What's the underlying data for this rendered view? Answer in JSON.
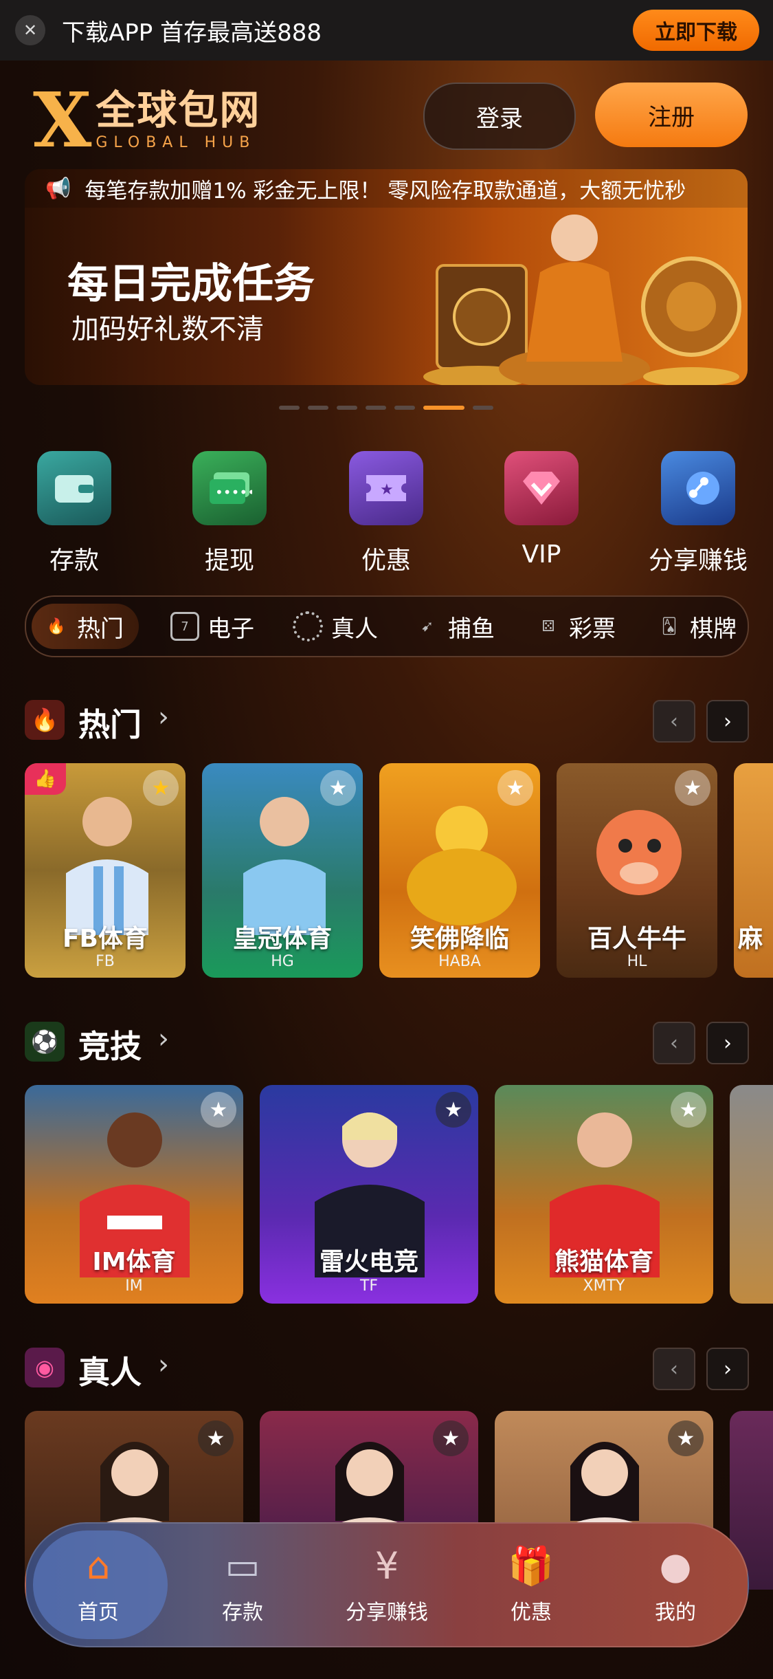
{
  "download_bar": {
    "text": "下载APP 首存最高送888",
    "button": "立即下载"
  },
  "header": {
    "logo_mark": "X",
    "logo_cn": "全球包网",
    "logo_en": "GLOBAL HUB",
    "login": "登录",
    "register": "注册"
  },
  "banner": {
    "marquee": "每笔存款加赠1% 彩金无上限！ 零风险存取款通道，大额无忧秒",
    "title": "每日完成任务",
    "subtitle": "加码好礼数不清",
    "active_slide": 6,
    "slide_count": 7
  },
  "quick_actions": [
    {
      "label": "存款",
      "icon": "wallet-icon"
    },
    {
      "label": "提现",
      "icon": "cash-card-icon"
    },
    {
      "label": "优惠",
      "icon": "coupon-ticket-icon"
    },
    {
      "label": "VIP",
      "icon": "diamond-icon"
    },
    {
      "label": "分享赚钱",
      "icon": "share-icon"
    }
  ],
  "categories": [
    {
      "label": "热门",
      "icon": "flame-icon"
    },
    {
      "label": "电子",
      "icon": "slot-icon"
    },
    {
      "label": "真人",
      "icon": "chip-icon"
    },
    {
      "label": "捕鱼",
      "icon": "fish-icon"
    },
    {
      "label": "彩票",
      "icon": "dice-icon"
    },
    {
      "label": "棋牌",
      "icon": "cards-icon"
    }
  ],
  "sections": {
    "hot": {
      "title": "热门",
      "cards": [
        {
          "name": "FB体育",
          "code": "FB"
        },
        {
          "name": "皇冠体育",
          "code": "HG"
        },
        {
          "name": "笑佛降临",
          "code": "HABA"
        },
        {
          "name": "百人牛牛",
          "code": "HL"
        },
        {
          "name": "麻",
          "code": ""
        }
      ]
    },
    "sports": {
      "title": "竞技",
      "cards": [
        {
          "name": "IM体育",
          "code": "IM"
        },
        {
          "name": "雷火电竞",
          "code": "TF"
        },
        {
          "name": "熊猫体育",
          "code": "XMTY"
        }
      ]
    },
    "live": {
      "title": "真人",
      "cards": [
        {
          "name": "",
          "code": ""
        },
        {
          "name": "",
          "code": ""
        },
        {
          "name": "",
          "code": ""
        }
      ]
    }
  },
  "bottom_nav": [
    {
      "label": "首页",
      "icon": "home-icon"
    },
    {
      "label": "存款",
      "icon": "wallet-icon"
    },
    {
      "label": "分享赚钱",
      "icon": "share-money-icon"
    },
    {
      "label": "优惠",
      "icon": "gift-icon"
    },
    {
      "label": "我的",
      "icon": "user-icon"
    }
  ],
  "colors": {
    "accent": "#f57a10",
    "gold": "#f7b24a",
    "background": "#1a0c06"
  }
}
